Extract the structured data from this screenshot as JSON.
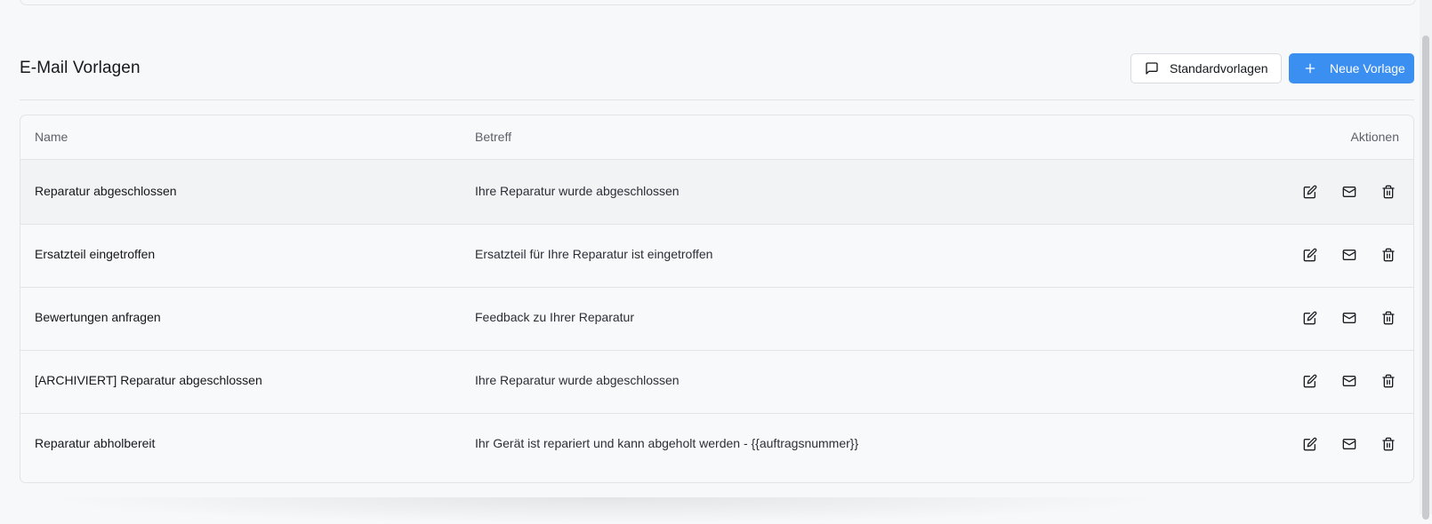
{
  "header": {
    "title": "E-Mail Vorlagen",
    "standard_templates_label": "Standardvorlagen",
    "new_template_label": "Neue Vorlage"
  },
  "table": {
    "columns": {
      "name": "Name",
      "subject": "Betreff",
      "actions": "Aktionen"
    },
    "rows": [
      {
        "name": "Reparatur abgeschlossen",
        "subject": "Ihre Reparatur wurde abgeschlossen"
      },
      {
        "name": "Ersatzteil eingetroffen",
        "subject": "Ersatzteil für Ihre Reparatur ist eingetroffen"
      },
      {
        "name": "Bewertungen anfragen",
        "subject": "Feedback zu Ihrer Reparatur"
      },
      {
        "name": "[ARCHIVIERT] Reparatur abgeschlossen",
        "subject": "Ihre Reparatur wurde abgeschlossen"
      },
      {
        "name": "Reparatur abholbereit",
        "subject": "Ihr Gerät ist repariert und kann abgeholt werden - {{auftragsnummer}}"
      }
    ],
    "row_actions": [
      "edit-icon",
      "mail-icon",
      "trash-icon"
    ]
  },
  "colors": {
    "primary": "#3b8ff0",
    "border": "#e2e4e8",
    "background": "#f7f8fa"
  }
}
